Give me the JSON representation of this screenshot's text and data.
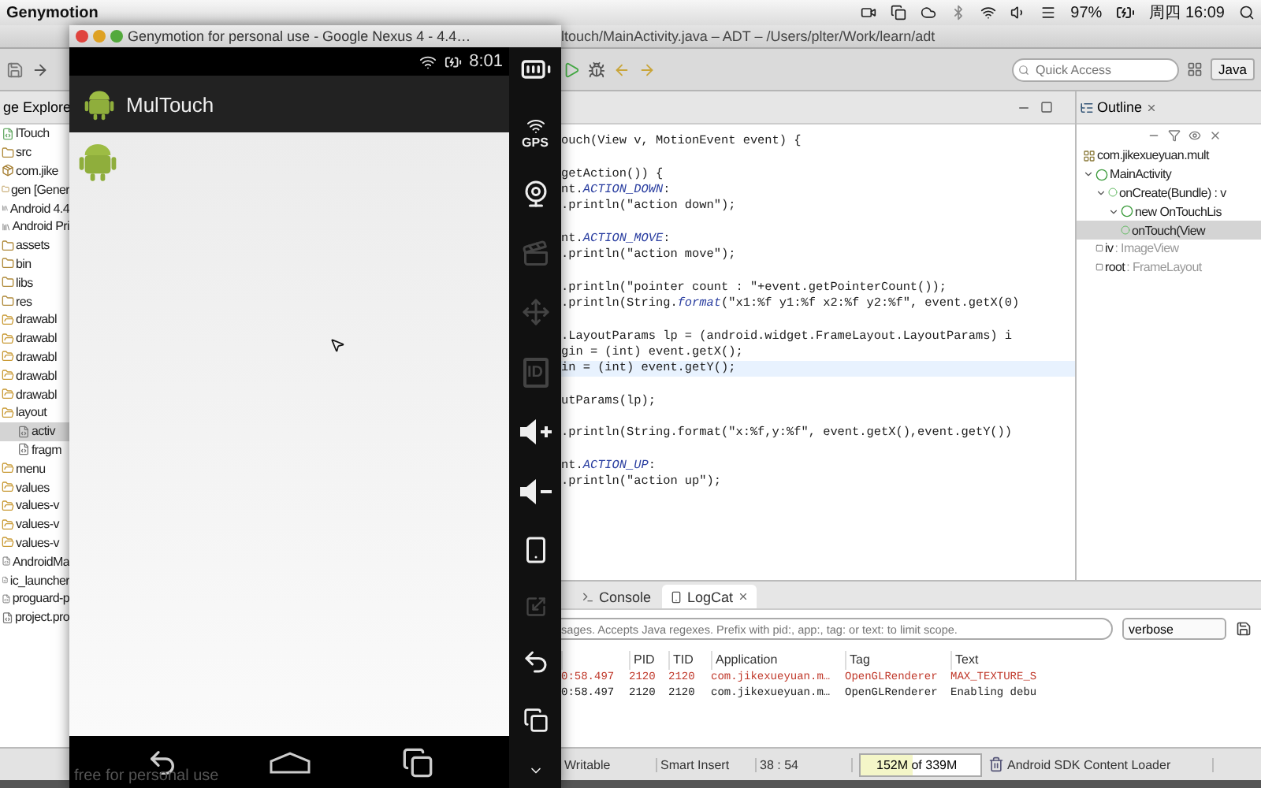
{
  "menubar": {
    "app": "Genymotion",
    "battery": "97%",
    "clock": "周四 16:09"
  },
  "ide": {
    "title": "ltouch/MainActivity.java – ADT – /Users/plter/Work/learn/adt",
    "quick_access": {
      "placeholder": "Quick Access"
    },
    "perspective": "Java"
  },
  "package_explorer": {
    "title": "ge Explore",
    "items": [
      {
        "label": "lTouch",
        "kind": "project",
        "selected": false
      },
      {
        "label": "src",
        "kind": "folder",
        "selected": false
      },
      {
        "label": "com.jike",
        "kind": "package",
        "selected": false
      },
      {
        "label": "gen [Gener",
        "kind": "folder",
        "selected": false
      },
      {
        "label": "Android 4.4",
        "kind": "library",
        "selected": false
      },
      {
        "label": "Android Pri",
        "kind": "library",
        "selected": false
      },
      {
        "label": "assets",
        "kind": "folder",
        "selected": false
      },
      {
        "label": "bin",
        "kind": "folder",
        "selected": false
      },
      {
        "label": "libs",
        "kind": "folder",
        "selected": false
      },
      {
        "label": "res",
        "kind": "folder",
        "selected": false
      },
      {
        "label": "drawabl",
        "kind": "open-folder",
        "selected": false
      },
      {
        "label": "drawabl",
        "kind": "open-folder",
        "selected": false
      },
      {
        "label": "drawabl",
        "kind": "open-folder",
        "selected": false
      },
      {
        "label": "drawabl",
        "kind": "open-folder",
        "selected": false
      },
      {
        "label": "drawabl",
        "kind": "open-folder",
        "selected": false
      },
      {
        "label": "layout",
        "kind": "open-folder",
        "selected": false,
        "children": [
          {
            "label": "activ",
            "kind": "file",
            "selected": true
          },
          {
            "label": "fragm",
            "kind": "file",
            "selected": false
          }
        ]
      },
      {
        "label": "menu",
        "kind": "open-folder",
        "selected": false
      },
      {
        "label": "values",
        "kind": "open-folder",
        "selected": false
      },
      {
        "label": "values-v",
        "kind": "open-folder",
        "selected": false
      },
      {
        "label": "values-v",
        "kind": "open-folder",
        "selected": false
      },
      {
        "label": "values-v",
        "kind": "open-folder",
        "selected": false
      },
      {
        "label": "AndroidMa",
        "kind": "file",
        "selected": false
      },
      {
        "label": "ic_launcher",
        "kind": "file",
        "selected": false
      },
      {
        "label": "proguard-p",
        "kind": "file",
        "selected": false
      },
      {
        "label": "project.pro",
        "kind": "file",
        "selected": false
      }
    ]
  },
  "editor": {
    "blocks": [
      [
        {
          "text": "ouch(View v, MotionEvent event) {",
          "current": false
        }
      ],
      [
        {
          "text": "getAction()) {",
          "current": false
        },
        {
          "text": "nt.*ACTION_DOWN*:",
          "current": false
        },
        {
          "text": ".println(\"action down\");",
          "current": false
        }
      ],
      [
        {
          "text": "nt.*ACTION_MOVE*:",
          "current": false
        },
        {
          "text": ".println(\"action move\");",
          "current": false
        }
      ],
      [
        {
          "text": ".println(\"pointer count : \"+event.getPointerCount());",
          "current": false
        },
        {
          "text": ".println(String.*format*(\"x1:%f y1:%f x2:%f y2:%f\", event.getX(0)",
          "current": false
        }
      ],
      [
        {
          "text": ".LayoutParams lp = (android.widget.FrameLayout.LayoutParams) i",
          "current": false
        },
        {
          "text": "gin = (int) event.getX();",
          "current": false
        },
        {
          "text": "in = (int) event.getY();",
          "current": true
        }
      ],
      [
        {
          "text": "utParams(lp);",
          "current": false
        }
      ],
      [
        {
          "text": ".println(String.format(\"x:%f,y:%f\", event.getX(),event.getY())",
          "current": false
        }
      ],
      [
        {
          "text": "nt.*ACTION_UP*:",
          "current": false
        },
        {
          "text": ".println(\"action up\");",
          "current": false
        }
      ]
    ]
  },
  "outline": {
    "title": "Outline",
    "items": [
      {
        "label": "com.jikexueyuan.mult",
        "kind": "package",
        "selected": false
      },
      {
        "label": "MainActivity",
        "kind": "class",
        "selected": false,
        "expanded": true,
        "children": [
          {
            "label": "onCreate(Bundle) : v",
            "kind": "method",
            "selected": false,
            "expanded": true,
            "children": [
              {
                "label": "new OnTouchLis",
                "kind": "class",
                "selected": false,
                "expanded": true,
                "children": [
                  {
                    "label": "onTouch(View",
                    "kind": "method",
                    "selected": true
                  }
                ]
              }
            ]
          },
          {
            "label": "iv",
            "type_label": ": ImageView",
            "kind": "field",
            "selected": false
          },
          {
            "label": "root",
            "type_label": ": FrameLayout",
            "kind": "field",
            "selected": false
          }
        ]
      }
    ]
  },
  "bottom_panel": {
    "tabs": [
      {
        "label": "Console",
        "selected": false
      },
      {
        "label": "LogCat",
        "selected": true
      }
    ],
    "filter": {
      "placeholder": "sages. Accepts Java regexes. Prefix with pid:, app:, tag: or text: to limit scope."
    },
    "log_level": "verbose",
    "columns": [
      "PID",
      "TID",
      "Application",
      "Tag",
      "Text"
    ],
    "rows": [
      {
        "time": "0:58.497",
        "pid": "2120",
        "tid": "2120",
        "application": "com.jikexueyuan.m…",
        "tag": "OpenGLRenderer",
        "text": "MAX_TEXTURE_S",
        "color": "#c0392b"
      },
      {
        "time": "0:58.497",
        "pid": "2120",
        "tid": "2120",
        "application": "com.jikexueyuan.m…",
        "tag": "OpenGLRenderer",
        "text": "Enabling debu",
        "color": "#222222"
      }
    ]
  },
  "status_bar": {
    "mode": "Writable",
    "insert": "Smart Insert",
    "position": "38 : 54",
    "memory": {
      "text": "152M of 339M",
      "level": 0.44
    },
    "job": "Android SDK Content Loader"
  },
  "emulator": {
    "title": "Genymotion for personal use - Google Nexus 4 - 4.4…",
    "clock": "8:01",
    "app_title": "MulTouch",
    "footer": "free for personal use",
    "controls": [
      {
        "kind": "battery",
        "disabled": false
      },
      {
        "kind": "gps",
        "label": "GPS",
        "disabled": false
      },
      {
        "kind": "webcam",
        "disabled": false
      },
      {
        "kind": "clapper",
        "disabled": true
      },
      {
        "kind": "dpad",
        "disabled": true
      },
      {
        "kind": "id",
        "label": "ID",
        "disabled": true
      },
      {
        "kind": "volume-up",
        "disabled": false
      },
      {
        "kind": "volume-down",
        "disabled": false
      },
      {
        "kind": "rotate",
        "disabled": false
      },
      {
        "kind": "scale",
        "disabled": true
      },
      {
        "kind": "back",
        "disabled": false
      },
      {
        "kind": "recents",
        "disabled": false
      },
      {
        "kind": "menu",
        "disabled": false
      }
    ]
  }
}
